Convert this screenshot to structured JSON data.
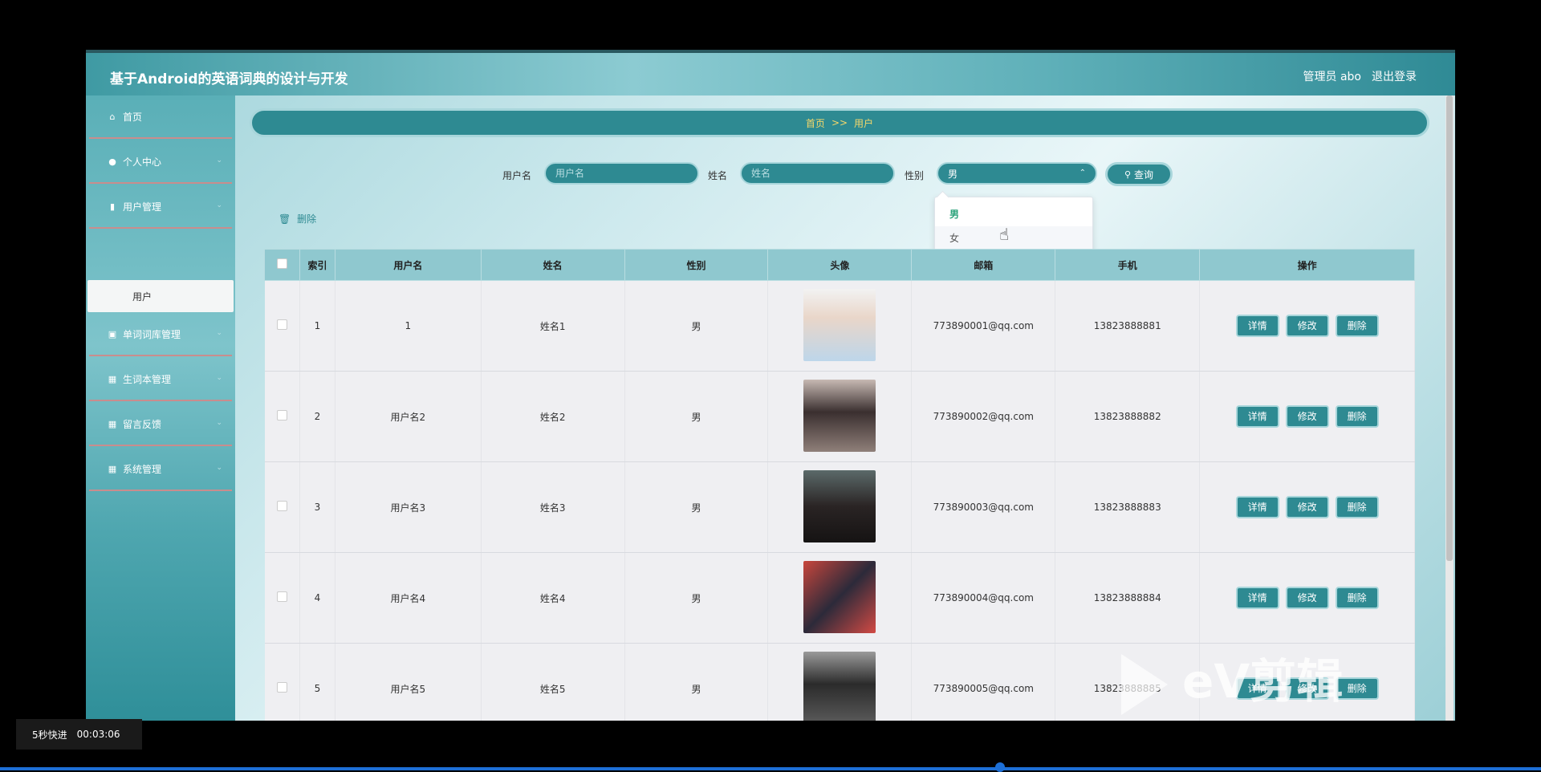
{
  "header": {
    "app_title": "基于Android的英语词典的设计与开发",
    "admin_label": "管理员 abo",
    "logout_label": "退出登录"
  },
  "sidebar": {
    "items": [
      {
        "label": "首页",
        "icon": "home-icon"
      },
      {
        "label": "个人中心",
        "icon": "person-icon"
      },
      {
        "label": "用户管理",
        "icon": "bar-chart-icon"
      },
      {
        "label": "单词词库管理",
        "icon": "book-icon"
      },
      {
        "label": "生词本管理",
        "icon": "grid-icon"
      },
      {
        "label": "留言反馈",
        "icon": "grid-icon"
      },
      {
        "label": "系统管理",
        "icon": "grid-icon"
      }
    ],
    "sub_item": "用户"
  },
  "breadcrumb": {
    "home": "首页",
    "sep": ">>",
    "current": "用户"
  },
  "filters": {
    "username_label": "用户名",
    "username_placeholder": "用户名",
    "name_label": "姓名",
    "name_placeholder": "姓名",
    "gender_label": "性别",
    "gender_value": "男",
    "search_label": "查询",
    "gender_options": [
      "男",
      "女"
    ]
  },
  "toolbar": {
    "delete_label": "删除"
  },
  "table": {
    "headers": [
      "索引",
      "用户名",
      "姓名",
      "性别",
      "头像",
      "邮箱",
      "手机",
      "操作"
    ],
    "rows": [
      {
        "index": "1",
        "username": "1",
        "name": "姓名1",
        "gender": "男",
        "email": "773890001@qq.com",
        "phone": "13823888881"
      },
      {
        "index": "2",
        "username": "用户名2",
        "name": "姓名2",
        "gender": "男",
        "email": "773890002@qq.com",
        "phone": "13823888882"
      },
      {
        "index": "3",
        "username": "用户名3",
        "name": "姓名3",
        "gender": "男",
        "email": "773890003@qq.com",
        "phone": "13823888883"
      },
      {
        "index": "4",
        "username": "用户名4",
        "name": "姓名4",
        "gender": "男",
        "email": "773890004@qq.com",
        "phone": "13823888884"
      },
      {
        "index": "5",
        "username": "用户名5",
        "name": "姓名5",
        "gender": "男",
        "email": "773890005@qq.com",
        "phone": "13823888885"
      }
    ],
    "actions": [
      "详情",
      "修改",
      "删除"
    ]
  },
  "player": {
    "speed_label": "5秒快进",
    "time": "00:03:06"
  },
  "colors": {
    "accent": "#2e8a92",
    "header_bg": "#8fc8cf",
    "breadcrumb_text": "#f5d86a"
  }
}
